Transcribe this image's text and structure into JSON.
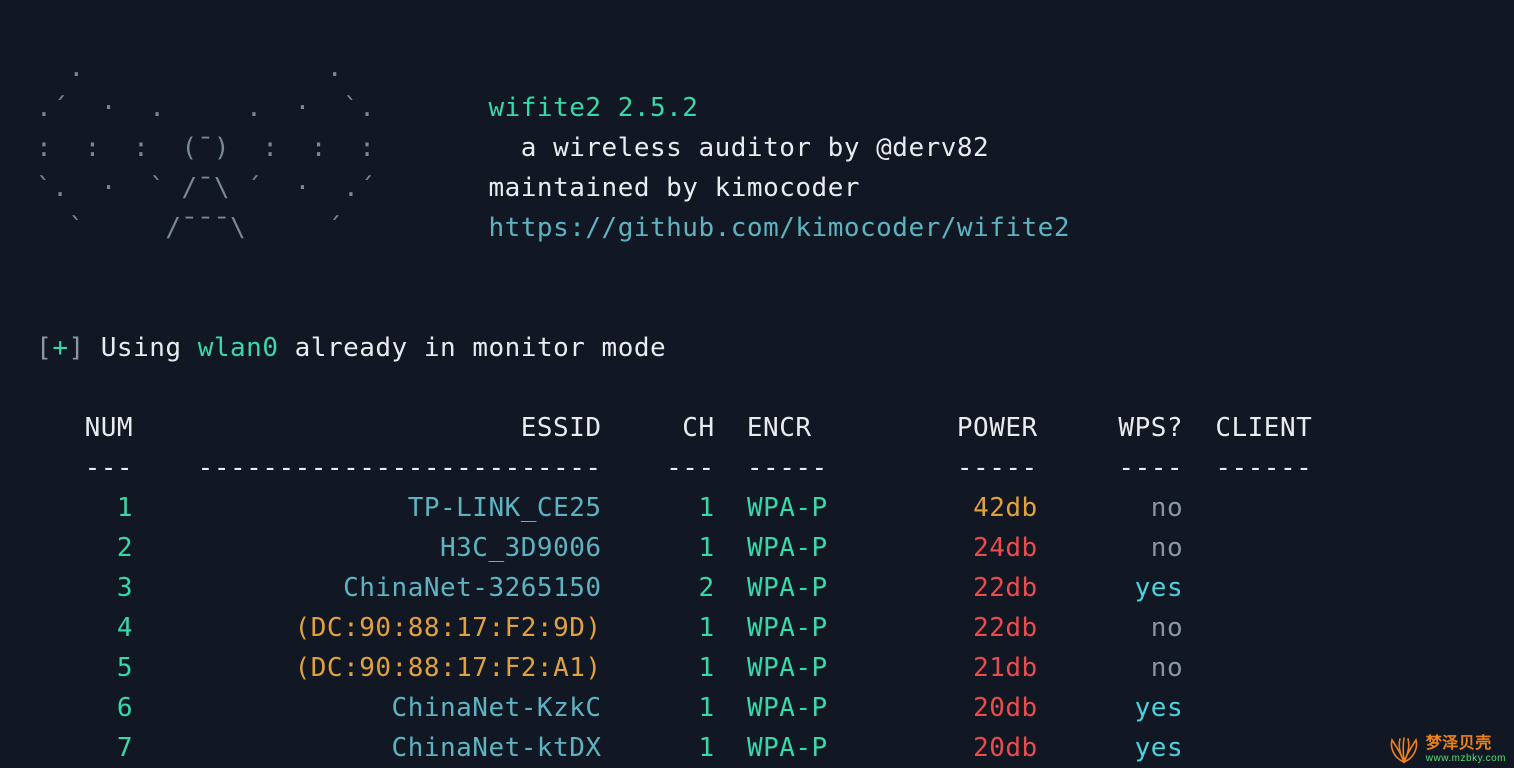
{
  "header": {
    "ascii": [
      "   .               .    ",
      " .´  ·  .     .  ·  `.  ",
      " :  :  :  (¯)  :  :  :  ",
      " `.  ·  ` /¯\\ ´  ·  .´  ",
      "   `     /¯¯¯\\     ´    "
    ],
    "title": "wifite2 2.5.2",
    "byline": "a wireless auditor by @derv82",
    "maintainer": "maintained by kimocoder",
    "url": "https://github.com/kimocoder/wifite2"
  },
  "status": {
    "prefix": "[",
    "plus": "+",
    "suffix": "]",
    "text_a": "Using ",
    "iface": "wlan0",
    "text_b": " already in monitor mode"
  },
  "table": {
    "headers": [
      "NUM",
      "ESSID",
      "CH",
      "ENCR",
      "POWER",
      "WPS?",
      "CLIENT"
    ],
    "divider": [
      "---",
      "-------------------------",
      "---",
      "-----",
      "-----",
      "----",
      "------"
    ],
    "rows": [
      {
        "num": "1",
        "essid": "TP-LINK_CE25",
        "essid_color": "teal",
        "ch": "1",
        "encr": "WPA-P",
        "power": "42db",
        "power_color": "orange",
        "wps": "no",
        "client": ""
      },
      {
        "num": "2",
        "essid": "H3C_3D9006",
        "essid_color": "teal",
        "ch": "1",
        "encr": "WPA-P",
        "power": "24db",
        "power_color": "red",
        "wps": "no",
        "client": ""
      },
      {
        "num": "3",
        "essid": "ChinaNet-3265150",
        "essid_color": "teal",
        "ch": "2",
        "encr": "WPA-P",
        "power": "22db",
        "power_color": "red",
        "wps": "yes",
        "client": ""
      },
      {
        "num": "4",
        "essid": "(DC:90:88:17:F2:9D)",
        "essid_color": "orange",
        "ch": "1",
        "encr": "WPA-P",
        "power": "22db",
        "power_color": "red",
        "wps": "no",
        "client": ""
      },
      {
        "num": "5",
        "essid": "(DC:90:88:17:F2:A1)",
        "essid_color": "orange",
        "ch": "1",
        "encr": "WPA-P",
        "power": "21db",
        "power_color": "red",
        "wps": "no",
        "client": ""
      },
      {
        "num": "6",
        "essid": "ChinaNet-KzkC",
        "essid_color": "teal",
        "ch": "1",
        "encr": "WPA-P",
        "power": "20db",
        "power_color": "red",
        "wps": "yes",
        "client": ""
      },
      {
        "num": "7",
        "essid": "ChinaNet-ktDX",
        "essid_color": "teal",
        "ch": "1",
        "encr": "WPA-P",
        "power": "20db",
        "power_color": "red",
        "wps": "yes",
        "client": ""
      }
    ]
  },
  "watermark": {
    "text1": "梦泽贝壳",
    "text2": "www.mzbky.com"
  },
  "colors": {
    "dim": "#7a8796",
    "green": "#38d9a9",
    "teal": "#5fb3c1",
    "orange": "#e0a13e",
    "cyan": "#4bd3dd",
    "red": "#e64d4d",
    "grey": "#8b95a3",
    "white": "#e8ecef",
    "background": "#111824"
  },
  "col_widths": {
    "num": 7,
    "essid": 27,
    "ch": 5,
    "encr": 8,
    "power": 8,
    "wps": 7,
    "client": 8
  }
}
